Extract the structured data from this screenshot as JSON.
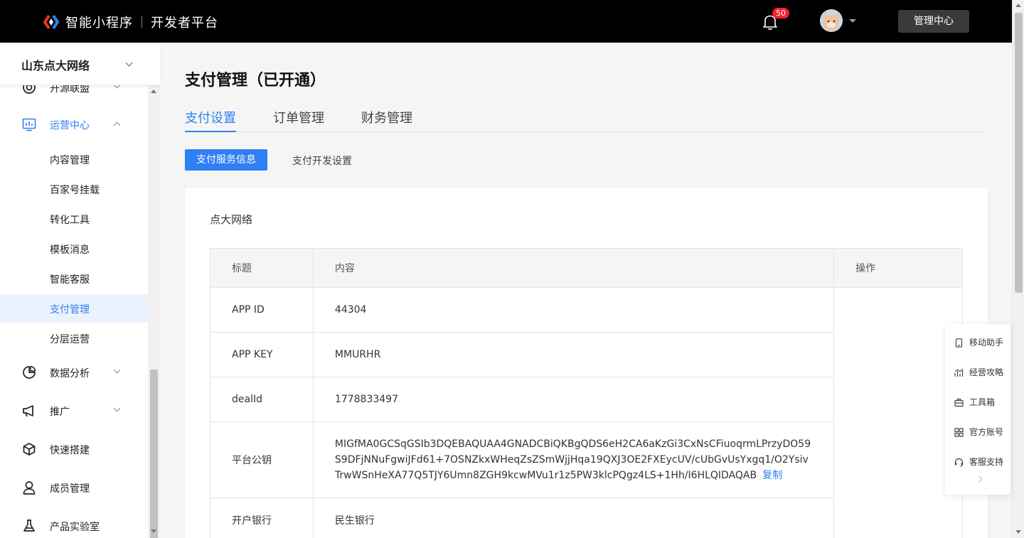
{
  "header": {
    "app_name": "智能小程序",
    "platform_name": "开发者平台",
    "notification_count": "50",
    "admin_button": "管理中心"
  },
  "sidebar": {
    "org_name": "山东点大网络",
    "items": [
      {
        "label": "开源联盟"
      },
      {
        "label": "运营中心"
      },
      {
        "label": "数据分析"
      },
      {
        "label": "推广"
      },
      {
        "label": "快速搭建"
      },
      {
        "label": "成员管理"
      },
      {
        "label": "产品实验室"
      }
    ],
    "sub_items": [
      {
        "label": "内容管理"
      },
      {
        "label": "百家号挂载"
      },
      {
        "label": "转化工具"
      },
      {
        "label": "模板消息"
      },
      {
        "label": "智能客服"
      },
      {
        "label": "支付管理"
      },
      {
        "label": "分层运营"
      }
    ]
  },
  "main": {
    "title": "支付管理（已开通）",
    "tabs": [
      {
        "label": "支付设置"
      },
      {
        "label": "订单管理"
      },
      {
        "label": "财务管理"
      }
    ],
    "subtabs": [
      {
        "label": "支付服务信息"
      },
      {
        "label": "支付开发设置"
      }
    ],
    "card_title": "点大网络",
    "table": {
      "headers": [
        "标题",
        "内容",
        "操作"
      ],
      "rows": [
        {
          "title": "APP ID",
          "content": "44304"
        },
        {
          "title": "APP KEY",
          "content": "MMURHR"
        },
        {
          "title": "dealId",
          "content": "1778833497"
        },
        {
          "title": "平台公钥",
          "content": "MIGfMA0GCSqGSIb3DQEBAQUAA4GNADCBiQKBgQDS6eH2CA6aKzGi3CxNsCFiuoqrmLPrzyDO59S9DFjNNuFgwiJFd61+7OSNZkxWHeqZsZSmWjjHqa19QXJ3OE2FXEycUV/cUbGvUsYxgq1/O2YsivTrwWSnHeXA77Q5TJY6Umn8ZGH9kcwMVu1r1z5PW3klcPQgz4LS+1Hh/I6HLQIDAQAB"
        },
        {
          "title": "开户银行",
          "content": "民生银行"
        }
      ],
      "copy_label": "复制"
    }
  },
  "float_panel": {
    "items": [
      {
        "label": "移动助手",
        "icon": "mobile-icon"
      },
      {
        "label": "经营攻略",
        "icon": "chart-icon"
      },
      {
        "label": "工具箱",
        "icon": "toolbox-icon"
      },
      {
        "label": "官方账号",
        "icon": "grid-icon"
      },
      {
        "label": "客服支持",
        "icon": "headset-icon"
      }
    ]
  },
  "colors": {
    "accent": "#2f7ff5",
    "topbar": "#000000",
    "badge": "#f5222d"
  }
}
